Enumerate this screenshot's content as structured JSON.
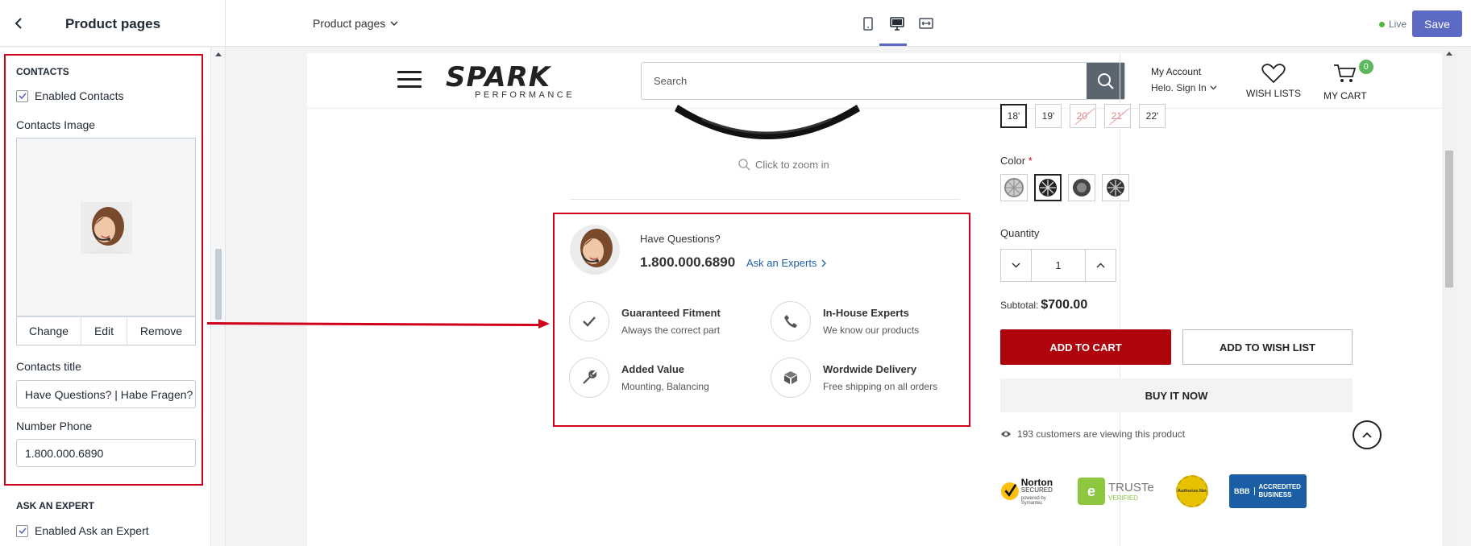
{
  "topbar": {
    "panel_title": "Product pages",
    "page_selector": "Product pages",
    "live_label": "Live",
    "save_label": "Save",
    "device_icons": [
      "mobile-icon",
      "desktop-icon",
      "fullwidth-icon"
    ],
    "active_device": "desktop-icon"
  },
  "sidebar": {
    "contacts_heading": "CONTACTS",
    "enabled_contacts_label": "Enabled Contacts",
    "enabled_contacts_checked": true,
    "contacts_image_label": "Contacts Image",
    "image_actions": [
      "Change",
      "Edit",
      "Remove"
    ],
    "contacts_title_label": "Contacts title",
    "contacts_title_value": "Have Questions? | Habe Fragen?",
    "number_phone_label": "Number Phone",
    "number_phone_value": "1.800.000.6890",
    "ask_expert_heading": "ASK AN EXPERT",
    "enabled_ask_label": "Enabled Ask an Expert",
    "enabled_ask_checked": true
  },
  "store": {
    "logo_text": "SPARK",
    "logo_sub": "PERFORMANCE",
    "search_placeholder": "Search",
    "account_title": "My Account",
    "account_sub": "Helo. Sign In",
    "wishlist_label": "WISH LISTS",
    "cart_label": "MY CART",
    "cart_count": "0",
    "zoom_text": "Click to zoom in"
  },
  "contact_block": {
    "title": "Have Questions?",
    "phone": "1.800.000.6890",
    "link": "Ask an Experts",
    "features": [
      {
        "title": "Guaranteed Fitment",
        "sub": "Always the correct part",
        "icon": "check-icon"
      },
      {
        "title": "In-House Experts",
        "sub": "We know our products",
        "icon": "phone-icon"
      },
      {
        "title": "Added Value",
        "sub": "Mounting, Balancing",
        "icon": "wrench-icon"
      },
      {
        "title": "Wordwide Delivery",
        "sub": "Free shipping on all orders",
        "icon": "box-icon"
      }
    ]
  },
  "product": {
    "sizes": [
      "18'",
      "19'",
      "20'",
      "21'",
      "22'"
    ],
    "active_size": "18'",
    "unavailable_sizes": [
      "20'",
      "21'"
    ],
    "color_label": "Color",
    "required_mark": "*",
    "quantity_label": "Quantity",
    "quantity_value": "1",
    "subtotal_label": "Subtotal:",
    "subtotal_value": "$700.00",
    "add_to_cart": "ADD TO CART",
    "add_to_wishlist": "ADD TO WISH LIST",
    "buy_now": "BUY IT NOW",
    "viewing_text": "193 customers are viewing this product",
    "trust_badges": {
      "norton_main": "Norton",
      "norton_sub": "SECURED",
      "norton_powered": "powered by Symantec",
      "truste_main": "TRUSTe",
      "truste_sub": "VERIFIED",
      "authorize": "Authorize.Net",
      "bbb_mark": "BBB",
      "bbb_line1": "ACCREDITED",
      "bbb_line2": "BUSINESS"
    }
  },
  "colors": {
    "accent": "#5c6ac4",
    "annotation_red": "#d0021b",
    "add_to_cart_red": "#b0040c",
    "cart_badge_green": "#5cb85c"
  }
}
